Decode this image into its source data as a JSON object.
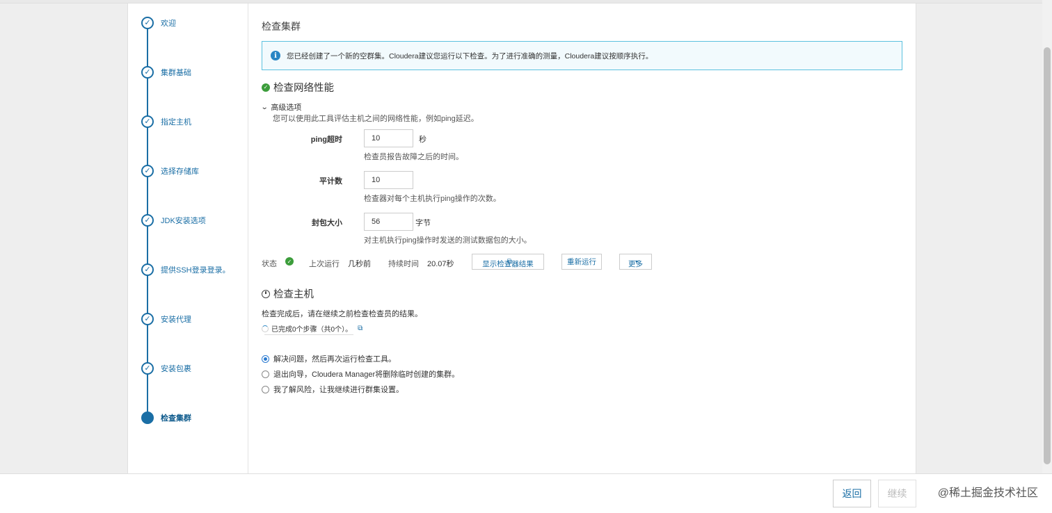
{
  "sidebar": {
    "steps": [
      {
        "label": "欢迎",
        "status": "done"
      },
      {
        "label": "集群基础",
        "status": "done"
      },
      {
        "label": "指定主机",
        "status": "done"
      },
      {
        "label": "选择存储库",
        "status": "done"
      },
      {
        "label": "JDK安装选项",
        "status": "done"
      },
      {
        "label": "提供SSH登录登录。",
        "status": "done"
      },
      {
        "label": "安装代理",
        "status": "done"
      },
      {
        "label": "安装包裹",
        "status": "done"
      },
      {
        "label": "检查集群",
        "status": "current"
      }
    ]
  },
  "main": {
    "title": "检查集群",
    "alert": "您已经创建了一个新的空群集。Cloudera建议您运行以下检查。为了进行准确的测量，Cloudera建议按顺序执行。",
    "network": {
      "title": "检查网络性能",
      "advanced_label": "高级选项",
      "advanced_desc": "您可以使用此工具评估主机之间的网络性能，例如ping延迟。",
      "fields": [
        {
          "label": "ping超时",
          "value": "10",
          "unit": "秒",
          "help": "检查员报告故障之后的时间。"
        },
        {
          "label": "平计数",
          "value": "10",
          "unit": "",
          "help": "检查器对每个主机执行ping操作的次数。"
        },
        {
          "label": "封包大小",
          "value": "56",
          "unit": "字节",
          "help": "对主机执行ping操作时发送的测试数据包的大小。"
        }
      ],
      "status_label": "状态",
      "last_run_label": "上次运行",
      "last_run_value": "几秒前",
      "duration_label": "持续时间",
      "duration_value": "20.07秒",
      "show_results_btn": "显示检查器结果",
      "rerun_btn": "重新运行",
      "more_btn": "更多"
    },
    "hosts": {
      "title": "检查主机",
      "desc": "检查完成后，请在继续之前检查检查员的结果。",
      "progress": "已完成0个步骤（共0个）。"
    },
    "options": [
      {
        "label": "解决问题，然后再次运行检查工具。",
        "selected": true
      },
      {
        "label": "退出向导，Cloudera Manager将删除临时创建的集群。",
        "selected": false
      },
      {
        "label": "我了解风险，让我继续进行群集设置。",
        "selected": false
      }
    ]
  },
  "footer": {
    "back_btn": "返回",
    "continue_btn": "继续",
    "watermark": "@稀土掘金技术社区"
  },
  "colors": {
    "accent": "#1a6ea5",
    "success": "#3c9d3b",
    "info_border": "#5bc0de"
  }
}
